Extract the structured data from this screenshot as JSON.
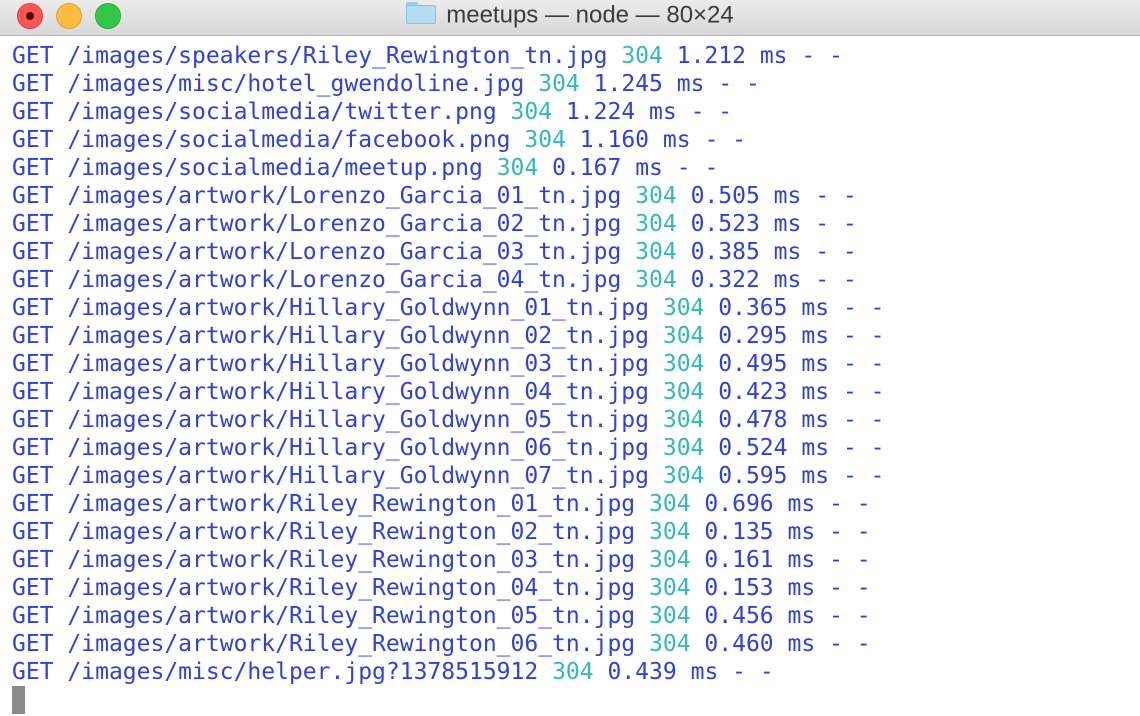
{
  "window": {
    "title": "meetups — node — 80×24"
  },
  "log_lines": [
    {
      "method": "GET",
      "path": "/images/speakers/Riley_Rewington_tn.jpg",
      "status": "304",
      "duration": "1.212",
      "unit": "ms",
      "trailer": "- -"
    },
    {
      "method": "GET",
      "path": "/images/misc/hotel_gwendoline.jpg",
      "status": "304",
      "duration": "1.245",
      "unit": "ms",
      "trailer": "- -"
    },
    {
      "method": "GET",
      "path": "/images/socialmedia/twitter.png",
      "status": "304",
      "duration": "1.224",
      "unit": "ms",
      "trailer": "- -"
    },
    {
      "method": "GET",
      "path": "/images/socialmedia/facebook.png",
      "status": "304",
      "duration": "1.160",
      "unit": "ms",
      "trailer": "- -"
    },
    {
      "method": "GET",
      "path": "/images/socialmedia/meetup.png",
      "status": "304",
      "duration": "0.167",
      "unit": "ms",
      "trailer": "- -"
    },
    {
      "method": "GET",
      "path": "/images/artwork/Lorenzo_Garcia_01_tn.jpg",
      "status": "304",
      "duration": "0.505",
      "unit": "ms",
      "trailer": "- -"
    },
    {
      "method": "GET",
      "path": "/images/artwork/Lorenzo_Garcia_02_tn.jpg",
      "status": "304",
      "duration": "0.523",
      "unit": "ms",
      "trailer": "- -"
    },
    {
      "method": "GET",
      "path": "/images/artwork/Lorenzo_Garcia_03_tn.jpg",
      "status": "304",
      "duration": "0.385",
      "unit": "ms",
      "trailer": "- -"
    },
    {
      "method": "GET",
      "path": "/images/artwork/Lorenzo_Garcia_04_tn.jpg",
      "status": "304",
      "duration": "0.322",
      "unit": "ms",
      "trailer": "- -"
    },
    {
      "method": "GET",
      "path": "/images/artwork/Hillary_Goldwynn_01_tn.jpg",
      "status": "304",
      "duration": "0.365",
      "unit": "ms",
      "trailer": "- -"
    },
    {
      "method": "GET",
      "path": "/images/artwork/Hillary_Goldwynn_02_tn.jpg",
      "status": "304",
      "duration": "0.295",
      "unit": "ms",
      "trailer": "- -"
    },
    {
      "method": "GET",
      "path": "/images/artwork/Hillary_Goldwynn_03_tn.jpg",
      "status": "304",
      "duration": "0.495",
      "unit": "ms",
      "trailer": "- -"
    },
    {
      "method": "GET",
      "path": "/images/artwork/Hillary_Goldwynn_04_tn.jpg",
      "status": "304",
      "duration": "0.423",
      "unit": "ms",
      "trailer": "- -"
    },
    {
      "method": "GET",
      "path": "/images/artwork/Hillary_Goldwynn_05_tn.jpg",
      "status": "304",
      "duration": "0.478",
      "unit": "ms",
      "trailer": "- -"
    },
    {
      "method": "GET",
      "path": "/images/artwork/Hillary_Goldwynn_06_tn.jpg",
      "status": "304",
      "duration": "0.524",
      "unit": "ms",
      "trailer": "- -"
    },
    {
      "method": "GET",
      "path": "/images/artwork/Hillary_Goldwynn_07_tn.jpg",
      "status": "304",
      "duration": "0.595",
      "unit": "ms",
      "trailer": "- -"
    },
    {
      "method": "GET",
      "path": "/images/artwork/Riley_Rewington_01_tn.jpg",
      "status": "304",
      "duration": "0.696",
      "unit": "ms",
      "trailer": "- -"
    },
    {
      "method": "GET",
      "path": "/images/artwork/Riley_Rewington_02_tn.jpg",
      "status": "304",
      "duration": "0.135",
      "unit": "ms",
      "trailer": "- -"
    },
    {
      "method": "GET",
      "path": "/images/artwork/Riley_Rewington_03_tn.jpg",
      "status": "304",
      "duration": "0.161",
      "unit": "ms",
      "trailer": "- -"
    },
    {
      "method": "GET",
      "path": "/images/artwork/Riley_Rewington_04_tn.jpg",
      "status": "304",
      "duration": "0.153",
      "unit": "ms",
      "trailer": "- -"
    },
    {
      "method": "GET",
      "path": "/images/artwork/Riley_Rewington_05_tn.jpg",
      "status": "304",
      "duration": "0.456",
      "unit": "ms",
      "trailer": "- -"
    },
    {
      "method": "GET",
      "path": "/images/artwork/Riley_Rewington_06_tn.jpg",
      "status": "304",
      "duration": "0.460",
      "unit": "ms",
      "trailer": "- -"
    },
    {
      "method": "GET",
      "path": "/images/misc/helper.jpg?1378515912",
      "status": "304",
      "duration": "0.439",
      "unit": "ms",
      "trailer": "- -"
    }
  ],
  "colors": {
    "text": "#2f3fe0",
    "status": "#35b8bc",
    "cursor": "#8a8a8a",
    "close_button": "#fc5753",
    "minimize_button": "#fdbc40",
    "zoom_button": "#33c748"
  },
  "icons": {
    "close": "close-icon",
    "minimize": "minimize-icon",
    "zoom": "zoom-icon",
    "folder": "folder-icon"
  }
}
